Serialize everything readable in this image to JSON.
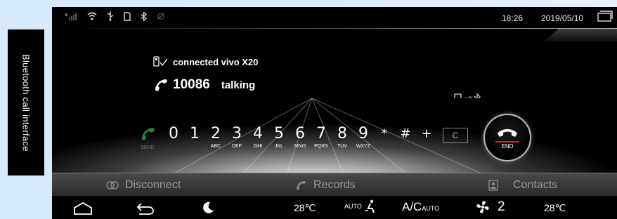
{
  "side_caption": "Bluetooth call interface",
  "statusbar": {
    "time": "18:26",
    "date": "2019/05/10",
    "icons": [
      "signal-icon",
      "wifi-icon",
      "usb-icon",
      "sd-card-icon",
      "bluetooth-icon",
      "gps-icon",
      "window-icon"
    ]
  },
  "connection": {
    "text": "connected vivo X20",
    "icon": "phone-check-icon"
  },
  "call": {
    "number": "10086",
    "state": "talking",
    "icon": "phone-handset-icon"
  },
  "dialpad": {
    "send_label": "SEND",
    "keys": [
      {
        "main": "0",
        "sub": ""
      },
      {
        "main": "1",
        "sub": ""
      },
      {
        "main": "2",
        "sub": "ABC"
      },
      {
        "main": "3",
        "sub": "DEF"
      },
      {
        "main": "4",
        "sub": "GHI"
      },
      {
        "main": "5",
        "sub": "JKL"
      },
      {
        "main": "6",
        "sub": "MNO"
      },
      {
        "main": "7",
        "sub": "PQRS"
      },
      {
        "main": "8",
        "sub": "TUV"
      },
      {
        "main": "9",
        "sub": "WXYZ"
      },
      {
        "main": "*",
        "sub": ""
      },
      {
        "main": "#",
        "sub": ""
      },
      {
        "main": "+",
        "sub": ""
      }
    ],
    "clear_label": "C",
    "end_label": "END"
  },
  "actions": {
    "disconnect": "Disconnect",
    "records": "Records",
    "contacts": "Contacts"
  },
  "dock": {
    "temp_left": "28℃",
    "auto_label": "AUTO",
    "ac_label": "A/C",
    "ac_sub": "AUTO",
    "fan_level": "2",
    "temp_right": "28℃"
  },
  "colors": {
    "accent_red": "#d81c1c",
    "send_green": "#2e7d32"
  }
}
